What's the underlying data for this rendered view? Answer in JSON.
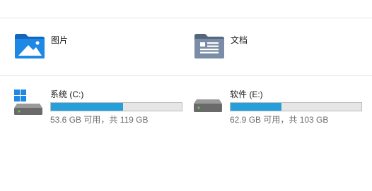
{
  "folders": [
    {
      "label": "图片",
      "icon": "pictures-folder-icon"
    },
    {
      "label": "文档",
      "icon": "documents-folder-icon"
    }
  ],
  "drives": [
    {
      "name": "系统 (C:)",
      "info": "53.6 GB 可用，共 119 GB",
      "used_fraction": 0.55,
      "icon": "windows-drive-icon"
    },
    {
      "name": "软件 (E:)",
      "info": "62.9 GB 可用，共 103 GB",
      "used_fraction": 0.39,
      "icon": "drive-icon"
    }
  ],
  "colors": {
    "usage_bar": "#26a0da",
    "bar_background": "#e6e6e6",
    "folder_blue": "#1e7fd8",
    "documents_folder": "#6b7f99"
  }
}
